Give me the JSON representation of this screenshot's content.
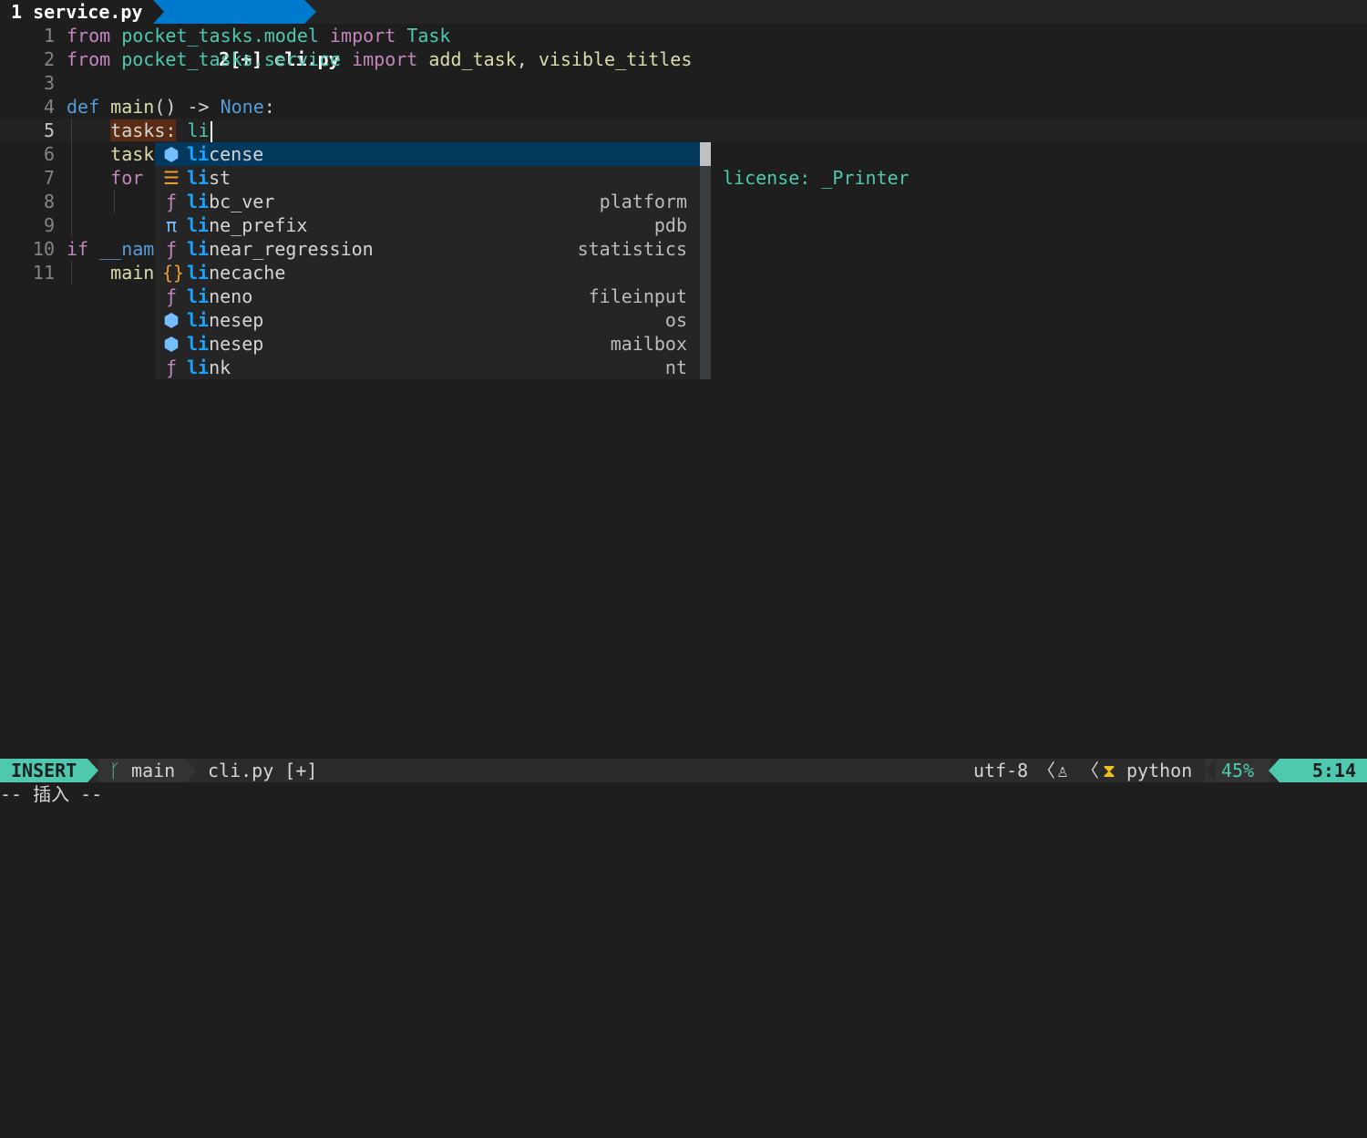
{
  "tabs": [
    {
      "label": "1 service.py",
      "active": false
    },
    {
      "label": "2[+] cli.py",
      "active": true
    }
  ],
  "editor": {
    "lines": [
      {
        "num": "1",
        "tokens": [
          {
            "t": "from",
            "c": "kw"
          },
          {
            "t": " ",
            "c": "pl"
          },
          {
            "t": "pocket_tasks.model",
            "c": "mod"
          },
          {
            "t": " ",
            "c": "pl"
          },
          {
            "t": "import",
            "c": "kw"
          },
          {
            "t": " ",
            "c": "pl"
          },
          {
            "t": "Task",
            "c": "cls"
          }
        ]
      },
      {
        "num": "2",
        "tokens": [
          {
            "t": "from",
            "c": "kw"
          },
          {
            "t": " ",
            "c": "pl"
          },
          {
            "t": "pocket_tasks.service",
            "c": "mod"
          },
          {
            "t": " ",
            "c": "pl"
          },
          {
            "t": "import",
            "c": "kw"
          },
          {
            "t": " ",
            "c": "pl"
          },
          {
            "t": "add_task",
            "c": "fn"
          },
          {
            "t": ", ",
            "c": "pl"
          },
          {
            "t": "visible_titles",
            "c": "fn"
          }
        ]
      },
      {
        "num": "3",
        "tokens": []
      },
      {
        "num": "4",
        "tokens": [
          {
            "t": "def",
            "c": "kw2"
          },
          {
            "t": " ",
            "c": "pl"
          },
          {
            "t": "main",
            "c": "fn"
          },
          {
            "t": "() -> ",
            "c": "pl"
          },
          {
            "t": "None",
            "c": "kw2"
          },
          {
            "t": ":",
            "c": "pl"
          }
        ]
      },
      {
        "num": "5",
        "tokens": [
          {
            "t": "    ",
            "c": "pl"
          },
          {
            "t": "tasks:",
            "c": "hlbg"
          },
          {
            "t": " ",
            "c": "pl"
          },
          {
            "t": "li",
            "c": "typed"
          }
        ],
        "current": true
      },
      {
        "num": "6",
        "tokens": [
          {
            "t": "    ",
            "c": "pl"
          },
          {
            "t": "task",
            "c": "fn"
          }
        ]
      },
      {
        "num": "7",
        "tokens": [
          {
            "t": "    ",
            "c": "pl"
          },
          {
            "t": "for",
            "c": "kw"
          }
        ]
      },
      {
        "num": "8",
        "tokens": []
      },
      {
        "num": "9",
        "tokens": []
      },
      {
        "num": "10",
        "tokens": [
          {
            "t": "if",
            "c": "kw"
          },
          {
            "t": " ",
            "c": "pl"
          },
          {
            "t": "__nam",
            "c": "kw2"
          }
        ]
      },
      {
        "num": "11",
        "tokens": [
          {
            "t": "    ",
            "c": "pl"
          },
          {
            "t": "main",
            "c": "fn"
          }
        ]
      }
    ]
  },
  "completion": {
    "match": "li",
    "items": [
      {
        "icon": "⬢",
        "icon_name": "module-icon",
        "icon_color": "#75beff",
        "match": "li",
        "rest": "cense",
        "source": "",
        "selected": true
      },
      {
        "icon": "☰",
        "icon_name": "class-icon",
        "icon_color": "#ee9d28",
        "match": "li",
        "rest": "st",
        "source": ""
      },
      {
        "icon": "ƒ",
        "icon_name": "function-icon",
        "icon_color": "#c586c0",
        "match": "li",
        "rest": "bc_ver",
        "source": "platform"
      },
      {
        "icon": "π",
        "icon_name": "constant-icon",
        "icon_color": "#75beff",
        "match": "li",
        "rest": "ne_prefix",
        "source": "pdb"
      },
      {
        "icon": "ƒ",
        "icon_name": "function-icon",
        "icon_color": "#c586c0",
        "match": "li",
        "rest": "near_regression",
        "source": "statistics"
      },
      {
        "icon": "{}",
        "icon_name": "namespace-icon",
        "icon_color": "#ee9d28",
        "match": "li",
        "rest": "necache",
        "source": ""
      },
      {
        "icon": "ƒ",
        "icon_name": "function-icon",
        "icon_color": "#c586c0",
        "match": "li",
        "rest": "neno",
        "source": "fileinput"
      },
      {
        "icon": "⬢",
        "icon_name": "module-icon",
        "icon_color": "#75beff",
        "match": "li",
        "rest": "nesep",
        "source": "os"
      },
      {
        "icon": "⬢",
        "icon_name": "module-icon",
        "icon_color": "#75beff",
        "match": "li",
        "rest": "nesep",
        "source": "mailbox"
      },
      {
        "icon": "ƒ",
        "icon_name": "function-icon",
        "icon_color": "#c586c0",
        "match": "li",
        "rest": "nk",
        "source": "nt"
      }
    ],
    "doc": "license: _Printer"
  },
  "statusline": {
    "mode": "INSERT",
    "branch_icon": "ᚴ",
    "branch": "main",
    "file": "cli.py [+]",
    "encoding": "utf-8",
    "separator": "〈",
    "os_icon": "♙",
    "filetype_icon": "⧗",
    "filetype": "python",
    "percent": "45%",
    "position": "5:14"
  },
  "cmdline": "-- 插入 --"
}
